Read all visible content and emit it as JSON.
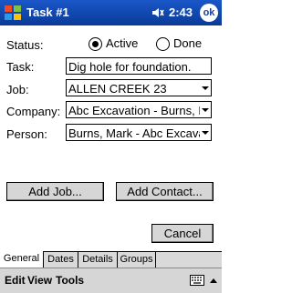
{
  "titlebar": {
    "title": "Task #1",
    "clock": "2:43",
    "ok_label": "ok"
  },
  "form": {
    "status_label": "Status:",
    "status_options": [
      "Active",
      "Done"
    ],
    "status_selected": "Active",
    "task_label": "Task:",
    "task_value": "Dig hole for foundation.",
    "job_label": "Job:",
    "job_value": "ALLEN CREEK 23",
    "company_label": "Company:",
    "company_value": "Abc Excavation - Burns, M...",
    "person_label": "Person:",
    "person_value": "Burns, Mark - Abc Excavati..."
  },
  "buttons": {
    "add_job": "Add Job...",
    "add_contact": "Add Contact...",
    "cancel": "Cancel"
  },
  "tabs": [
    "General",
    "Dates",
    "Details",
    "Groups"
  ],
  "tab_selected": "General",
  "menubar": {
    "items": [
      "Edit",
      "View",
      "Tools"
    ]
  },
  "colors": {
    "titlebar": "#0f47b4",
    "button_face": "#d6d6d6"
  }
}
